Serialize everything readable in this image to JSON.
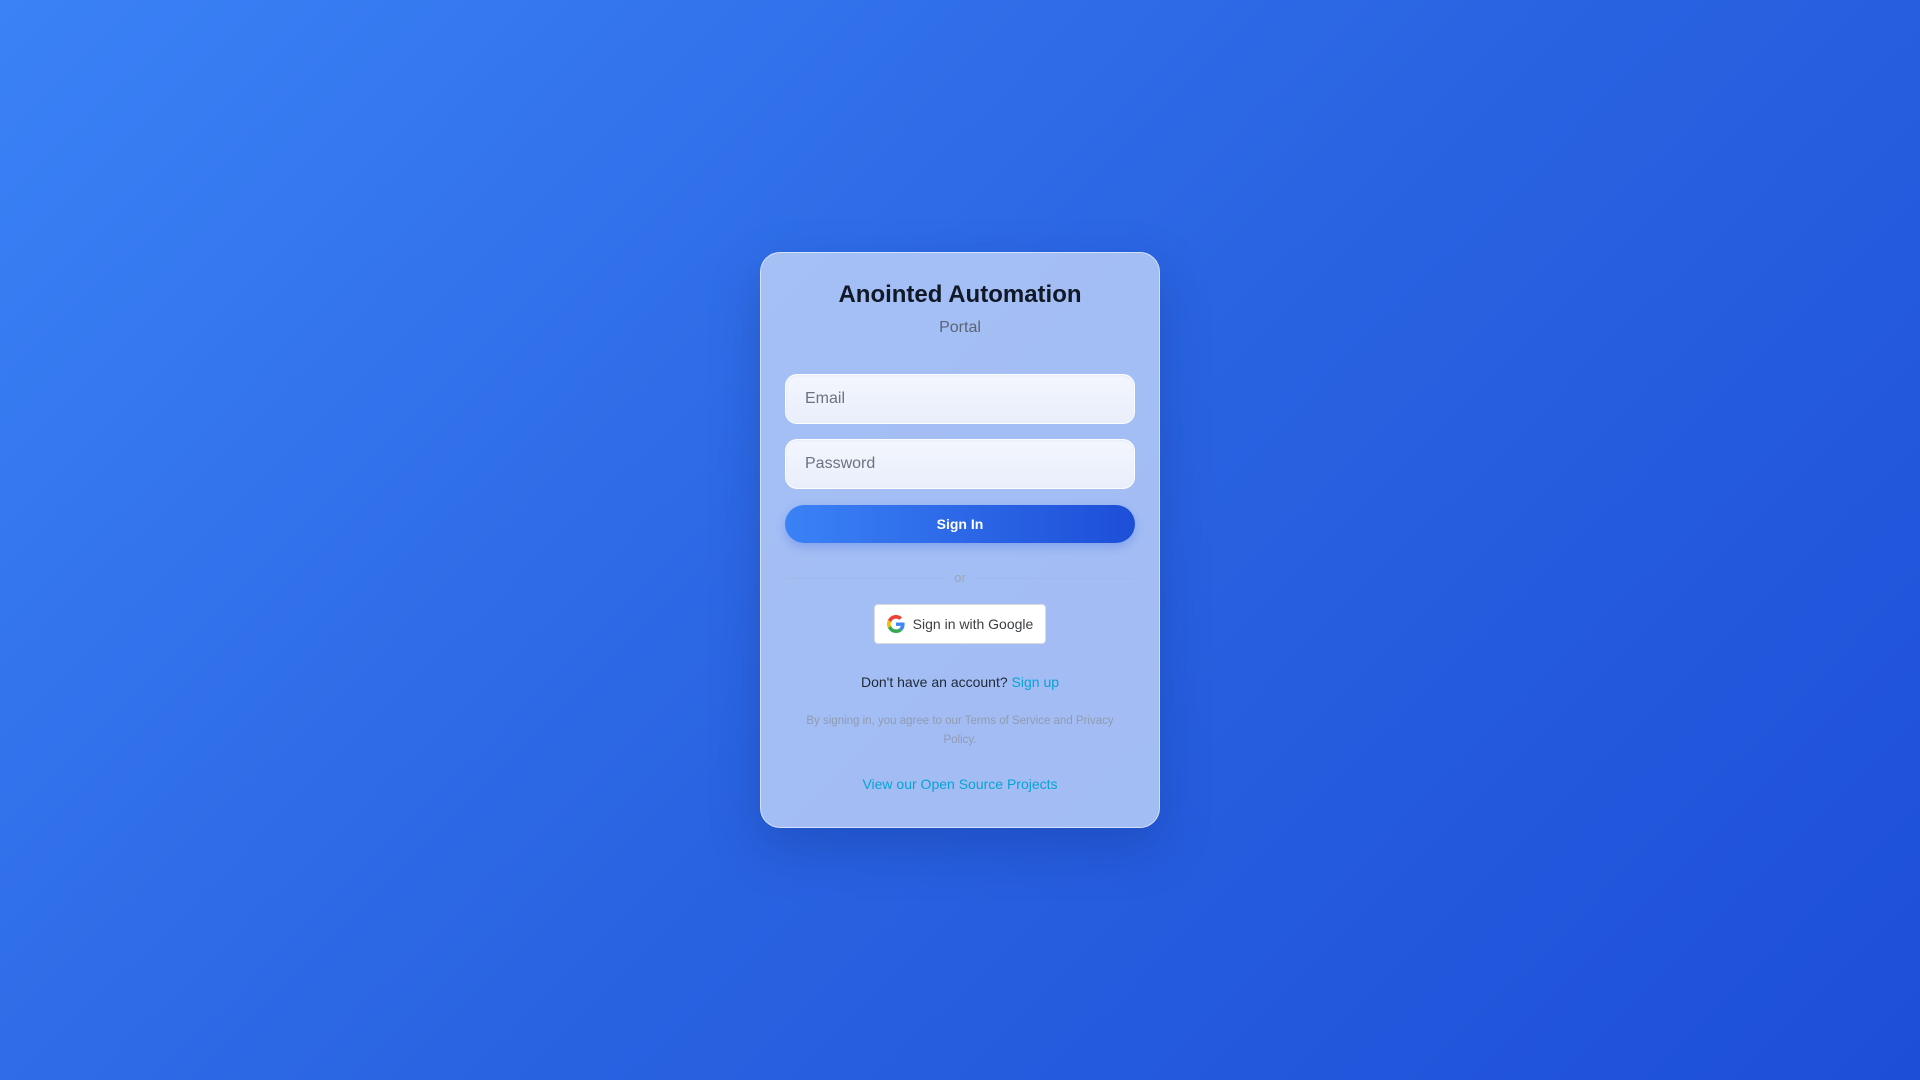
{
  "app": {
    "title": "Anointed Automation",
    "subtitle": "Portal"
  },
  "form": {
    "email_placeholder": "Email",
    "email_value": "",
    "password_placeholder": "Password",
    "password_value": "",
    "signin_label": "Sign In",
    "divider_label": "or",
    "google_label": "Sign in with Google"
  },
  "footer": {
    "signup_prompt": "Don't have an account?",
    "signup_link": "Sign up",
    "terms_text": "By signing in, you agree to our Terms of Service and Privacy Policy.",
    "oss_link": "View our Open Source Projects"
  },
  "icons": {
    "google": "google-g-icon"
  },
  "colors": {
    "background_start": "#3b82f6",
    "background_end": "#1d4ed8",
    "button_start": "#3b82f6",
    "button_end": "#1d4ed8",
    "link": "#06a3d6"
  }
}
